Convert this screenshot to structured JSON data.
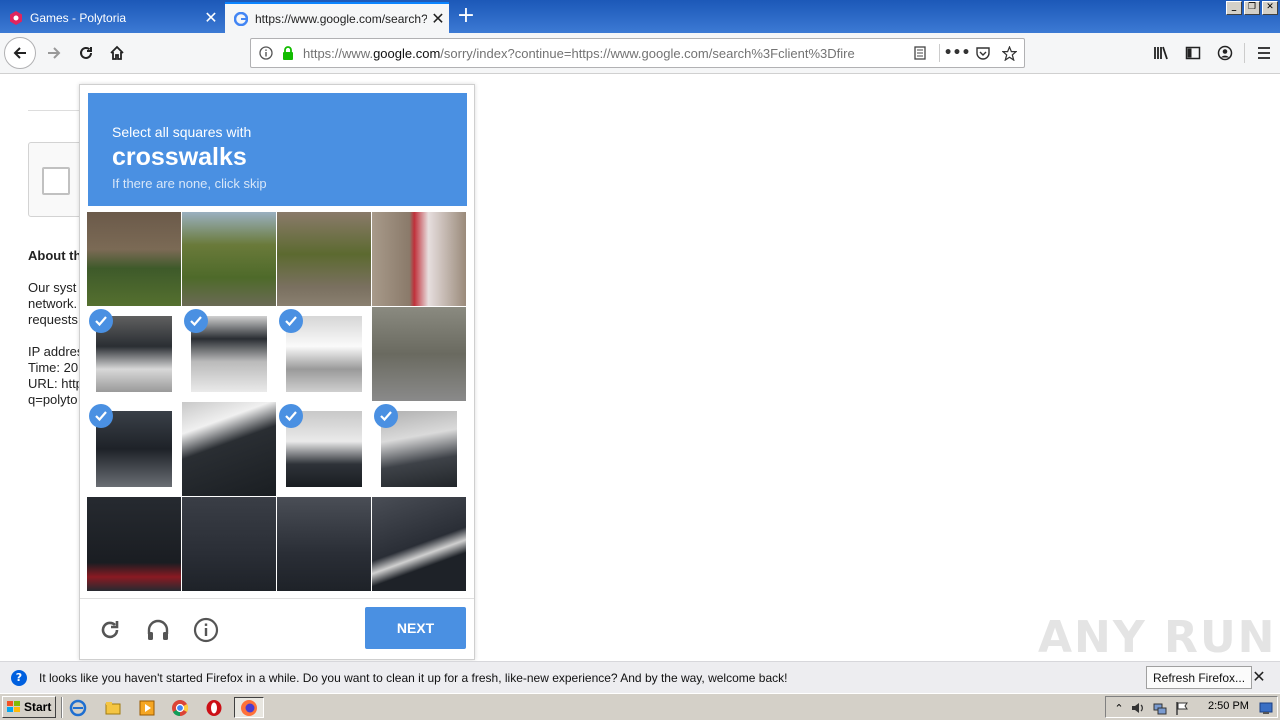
{
  "browser": {
    "tabs": [
      {
        "title": "Games - Polytoria",
        "active": false,
        "icon": "polytoria-icon"
      },
      {
        "title": "https://www.google.com/search?c",
        "active": true,
        "icon": "google-icon"
      }
    ],
    "url_prefix": "https://www.",
    "url_domain": "google.com",
    "url_rest": "/sorry/index?continue=https://www.google.com/search%3Fclient%3Dfire"
  },
  "background_page": {
    "about_heading": "About th",
    "lines_group1": [
      "Our syst",
      "network.",
      "requests"
    ],
    "lines_group2": [
      "IP addres",
      "Time: 20",
      "URL: http",
      "q=polyto"
    ]
  },
  "captcha": {
    "instruction": "Select all squares with",
    "keyword": "crosswalks",
    "hint": "If there are none, click skip",
    "next_label": "NEXT",
    "selected_tiles": [
      4,
      5,
      6,
      8,
      10,
      11
    ],
    "colors": {
      "accent": "#4a90e2"
    }
  },
  "watermark": "ANY RUN",
  "notification": {
    "message": "It looks like you haven't started Firefox in a while. Do you want to clean it up for a fresh, like-new experience? And by the way, welcome back!",
    "refresh_label": "Refresh Firefox..."
  },
  "taskbar": {
    "start_label": "Start",
    "clock": "2:50 PM"
  }
}
